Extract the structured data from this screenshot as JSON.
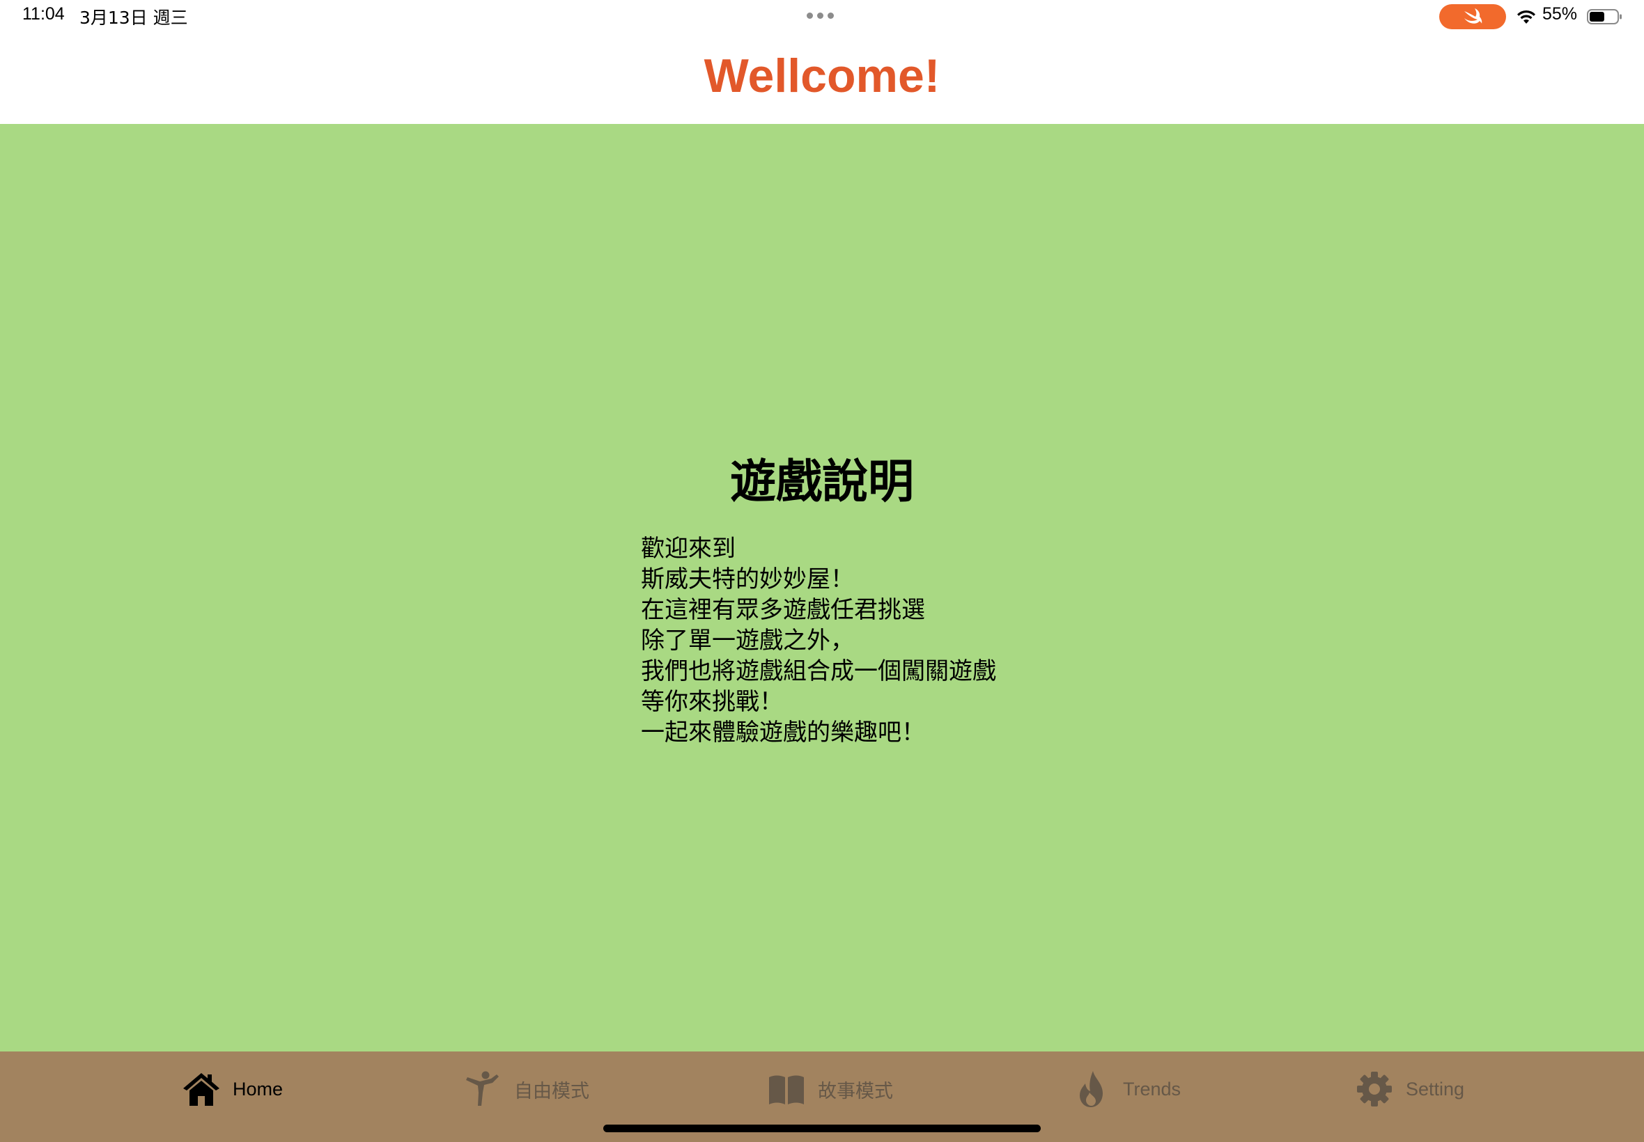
{
  "status_bar": {
    "time": "11:04",
    "date": "3月13日 週三",
    "battery_percent": "55%",
    "battery_level": 0.55,
    "accent_color": "#f26a2c"
  },
  "header": {
    "title": "Wellcome!",
    "title_color": "#e2582a"
  },
  "main": {
    "background_color": "#a9d983",
    "title": "遊戲說明",
    "lines": [
      "歡迎來到",
      "斯威夫特的妙妙屋！",
      "在這裡有眾多遊戲任君挑選",
      "除了單一遊戲之外，",
      "我們也將遊戲組合成一個闖關遊戲",
      "等你來挑戰！",
      "一起來體驗遊戲的樂趣吧！"
    ]
  },
  "tab_bar": {
    "background_color": "#a2835f",
    "tabs": [
      {
        "label": "Home",
        "icon": "house-icon",
        "active": true
      },
      {
        "label": "自由模式",
        "icon": "martial-arts-icon",
        "active": false
      },
      {
        "label": "故事模式",
        "icon": "book-icon",
        "active": false
      },
      {
        "label": "Trends",
        "icon": "flame-icon",
        "active": false
      },
      {
        "label": "Setting",
        "icon": "gear-icon",
        "active": false
      }
    ]
  }
}
